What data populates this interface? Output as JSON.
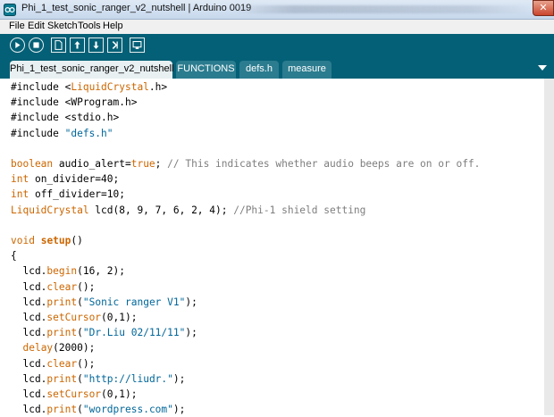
{
  "window": {
    "title": "Phi_1_test_sonic_ranger_v2_nutshell | Arduino 0019",
    "close_glyph": "✕"
  },
  "menu": [
    "File",
    "Edit",
    "Sketch",
    "Tools",
    "Help"
  ],
  "toolbar": {
    "buttons": [
      "verify-icon",
      "stop-icon",
      "new-icon",
      "open-icon",
      "save-icon",
      "upload-icon",
      "serial-monitor-icon"
    ]
  },
  "tabs": [
    {
      "label": "Phi_1_test_sonic_ranger_v2_nutshell",
      "active": true
    },
    {
      "label": "FUNCTIONS",
      "active": false
    },
    {
      "label": "defs.h",
      "active": false
    },
    {
      "label": "measure",
      "active": false
    }
  ],
  "colors": {
    "toolbar_bg": "#046076",
    "keyword": "#cc6600",
    "string": "#006699",
    "comment": "#7e7e7e"
  },
  "code_lines": [
    [
      {
        "t": "#include <"
      },
      {
        "t": "LiquidCrystal",
        "c": "kw"
      },
      {
        "t": ".h>"
      }
    ],
    [
      {
        "t": "#include <WProgram.h>"
      }
    ],
    [
      {
        "t": "#include <stdio.h>"
      }
    ],
    [
      {
        "t": "#include "
      },
      {
        "t": "\"defs.h\"",
        "c": "str"
      }
    ],
    [],
    [
      {
        "t": "boolean",
        "c": "kw"
      },
      {
        "t": " audio_alert="
      },
      {
        "t": "true",
        "c": "kw"
      },
      {
        "t": "; "
      },
      {
        "t": "// This indicates whether audio beeps are on or off.",
        "c": "cm"
      }
    ],
    [
      {
        "t": "int",
        "c": "kw"
      },
      {
        "t": " on_divider=40;"
      }
    ],
    [
      {
        "t": "int",
        "c": "kw"
      },
      {
        "t": " off_divider=10;"
      }
    ],
    [
      {
        "t": "LiquidCrystal",
        "c": "kw"
      },
      {
        "t": " lcd(8, 9, 7, 6, 2, 4); "
      },
      {
        "t": "//Phi-1 shield setting",
        "c": "cm"
      }
    ],
    [],
    [
      {
        "t": "void",
        "c": "kw"
      },
      {
        "t": " "
      },
      {
        "t": "setup",
        "c": "kwb"
      },
      {
        "t": "()"
      }
    ],
    [
      {
        "t": "{"
      }
    ],
    [
      {
        "t": "  lcd."
      },
      {
        "t": "begin",
        "c": "kw"
      },
      {
        "t": "(16, 2);"
      }
    ],
    [
      {
        "t": "  lcd."
      },
      {
        "t": "clear",
        "c": "kw"
      },
      {
        "t": "();"
      }
    ],
    [
      {
        "t": "  lcd."
      },
      {
        "t": "print",
        "c": "kw"
      },
      {
        "t": "("
      },
      {
        "t": "\"Sonic ranger V1\"",
        "c": "str"
      },
      {
        "t": ");"
      }
    ],
    [
      {
        "t": "  lcd."
      },
      {
        "t": "setCursor",
        "c": "kw"
      },
      {
        "t": "(0,1);"
      }
    ],
    [
      {
        "t": "  lcd."
      },
      {
        "t": "print",
        "c": "kw"
      },
      {
        "t": "("
      },
      {
        "t": "\"Dr.Liu 02/11/11\"",
        "c": "str"
      },
      {
        "t": ");"
      }
    ],
    [
      {
        "t": "  "
      },
      {
        "t": "delay",
        "c": "kw"
      },
      {
        "t": "(2000);"
      }
    ],
    [
      {
        "t": "  lcd."
      },
      {
        "t": "clear",
        "c": "kw"
      },
      {
        "t": "();"
      }
    ],
    [
      {
        "t": "  lcd."
      },
      {
        "t": "print",
        "c": "kw"
      },
      {
        "t": "("
      },
      {
        "t": "\"http://liudr.\"",
        "c": "str"
      },
      {
        "t": ");"
      }
    ],
    [
      {
        "t": "  lcd."
      },
      {
        "t": "setCursor",
        "c": "kw"
      },
      {
        "t": "(0,1);"
      }
    ],
    [
      {
        "t": "  lcd."
      },
      {
        "t": "print",
        "c": "kw"
      },
      {
        "t": "("
      },
      {
        "t": "\"wordpress.com\"",
        "c": "str"
      },
      {
        "t": ");"
      }
    ]
  ]
}
